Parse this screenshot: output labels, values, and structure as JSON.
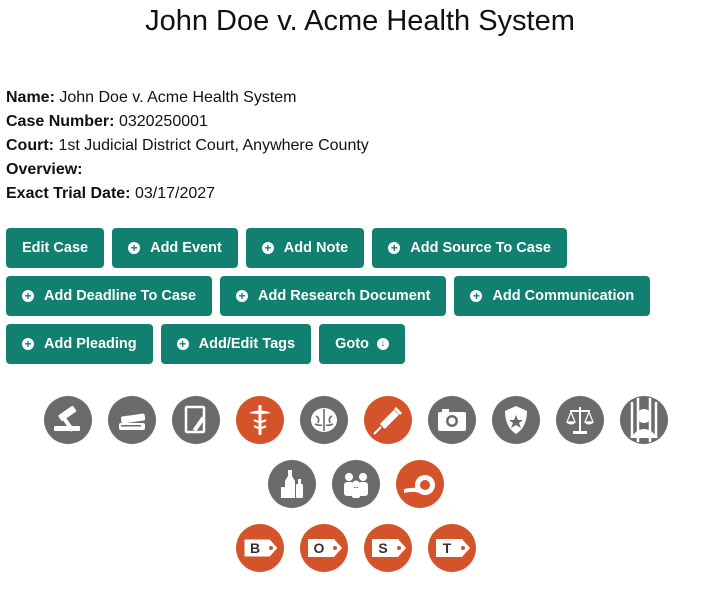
{
  "case": {
    "title": "John Doe v. Acme Health System",
    "fields": {
      "name_label": "Name:",
      "name": "John Doe v. Acme Health System",
      "number_label": "Case Number:",
      "number": "0320250001",
      "court_label": "Court:",
      "court": "1st Judicial District Court, Anywhere County",
      "overview_label": "Overview:",
      "overview": "",
      "trial_label": "Exact Trial Date:",
      "trial": "03/17/2027"
    }
  },
  "buttons": {
    "edit_case": "Edit Case",
    "add_event": "Add Event",
    "add_note": "Add Note",
    "add_source": "Add Source To Case",
    "add_deadline": "Add Deadline To Case",
    "add_research": "Add Research Document",
    "add_communication": "Add Communication",
    "add_pleading": "Add Pleading",
    "add_edit_tags": "Add/Edit Tags",
    "goto": "Goto"
  },
  "icons": {
    "row1": [
      "gavel-icon",
      "books-icon",
      "document-pen-icon",
      "medical-caduceus-icon",
      "brain-icon",
      "syringe-icon",
      "camera-icon",
      "police-badge-icon",
      "scales-of-justice-icon",
      "inmate-icon"
    ],
    "row2": [
      "bottles-icon",
      "family-icon",
      "bandage-roll-icon"
    ],
    "tags": [
      "B",
      "O",
      "S",
      "T"
    ]
  },
  "colors": {
    "accent": "#128070",
    "icon_gray": "#6b6b6b",
    "icon_orange": "#d4532a"
  }
}
